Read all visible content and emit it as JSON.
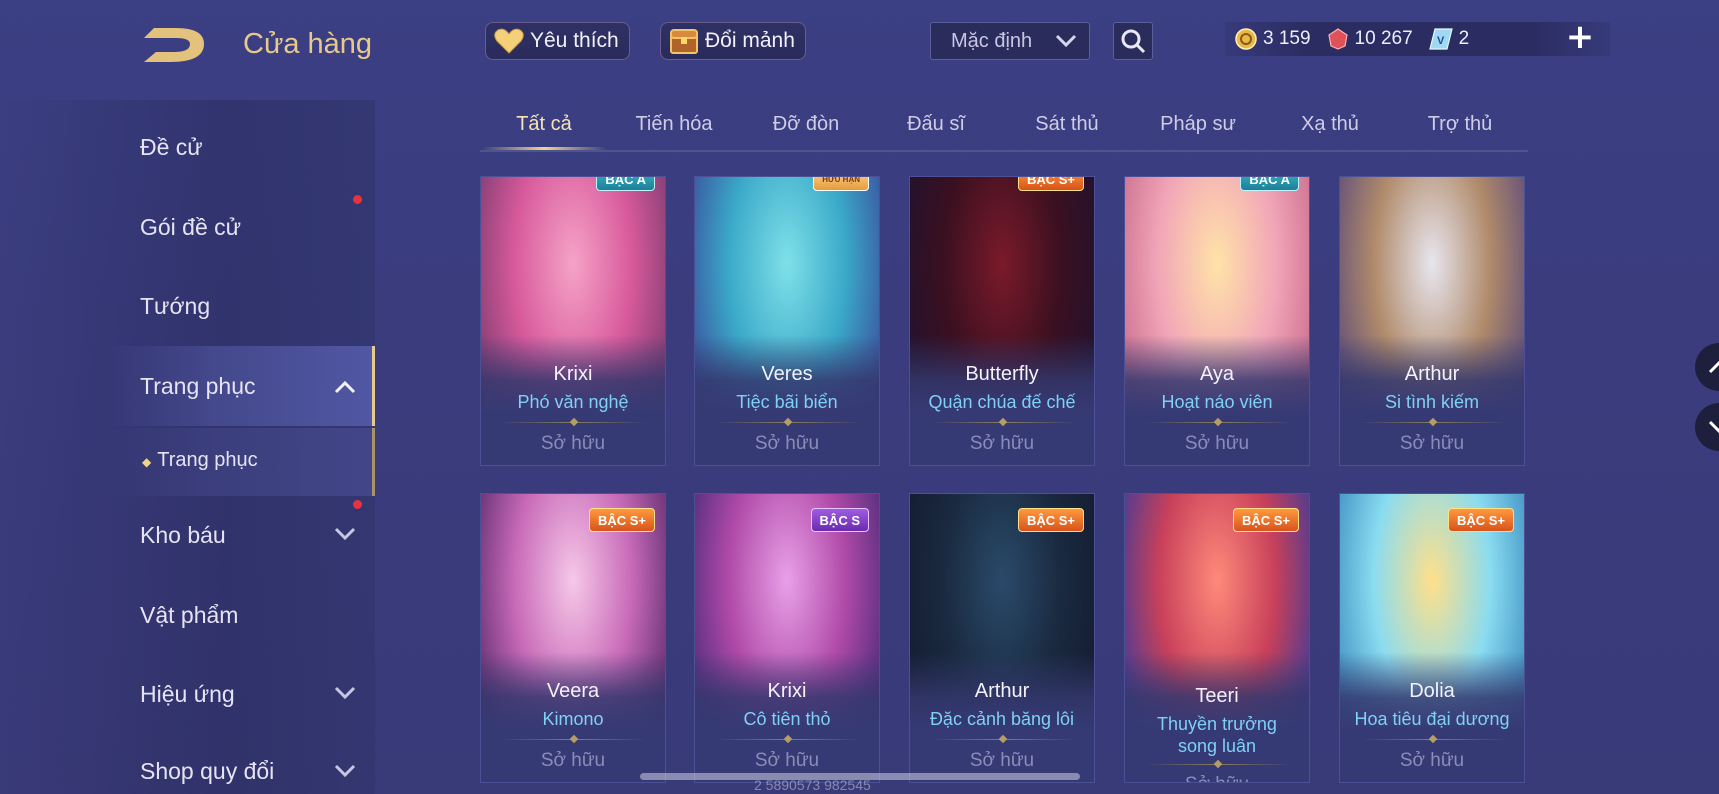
{
  "header": {
    "title": "Cửa hàng",
    "favorites_label": "Yêu thích",
    "exchange_label": "Đổi mảnh",
    "sort_value": "Mặc định",
    "currencies": [
      {
        "name": "gold-coin-icon",
        "value": "3 159"
      },
      {
        "name": "ruby-icon",
        "value": "10 267"
      },
      {
        "name": "voucher-icon",
        "value": "2"
      }
    ],
    "plus_label": "+"
  },
  "sidebar": {
    "items": [
      {
        "label": "Đề cử",
        "dot": false
      },
      {
        "label": "Gói đề cử",
        "dot": true
      },
      {
        "label": "Tướng",
        "dot": false
      },
      {
        "label": "Trang phục",
        "dot": false,
        "expanded": true
      },
      {
        "label": "Trang phục",
        "sub": true
      },
      {
        "label": "Kho báu",
        "dot": true
      },
      {
        "label": "Vật phẩm",
        "dot": false
      },
      {
        "label": "Hiệu ứng",
        "dot": false
      },
      {
        "label": "Shop quy đổi",
        "dot": false
      }
    ]
  },
  "tabs": [
    "Tất cả",
    "Tiến hóa",
    "Đỡ đòn",
    "Đấu sĩ",
    "Sát thủ",
    "Pháp sư",
    "Xạ thủ",
    "Trợ thủ"
  ],
  "active_tab": "Tất cả",
  "cards": [
    {
      "hero": "Krixi",
      "skin": "Phó văn nghệ",
      "status": "Sở hữu",
      "badge": "BẬC A",
      "badge_type": "a",
      "colors": [
        "#f5a3c7",
        "#d85a9c",
        "#7a3a6e"
      ]
    },
    {
      "hero": "Veres",
      "skin": "Tiệc bãi biển",
      "status": "Sở hữu",
      "badge": "HỮU HẠN",
      "badge_type": "ltd",
      "colors": [
        "#7fe0e8",
        "#3aa9c9",
        "#3b4b9a"
      ]
    },
    {
      "hero": "Butterfly",
      "skin": "Quận chúa đế chế",
      "status": "Sở hữu",
      "badge": "BẬC S+",
      "badge_type": "spl",
      "colors": [
        "#7a1a2a",
        "#3b1020",
        "#1f1230"
      ]
    },
    {
      "hero": "Aya",
      "skin": "Hoạt náo viên",
      "status": "Sở hữu",
      "badge": "BẬC A",
      "badge_type": "a",
      "colors": [
        "#ffe3a8",
        "#f2a6b8",
        "#c86a8c"
      ]
    },
    {
      "hero": "Arthur",
      "skin": "Si tình kiếm",
      "status": "Sở hữu",
      "badge": "",
      "badge_type": "",
      "colors": [
        "#e8e6ef",
        "#b08a6a",
        "#5a4a7a"
      ]
    },
    {
      "hero": "Veera",
      "skin": "Kimono",
      "status": "Sở hữu",
      "badge": "BẬC S+",
      "badge_type": "spl",
      "colors": [
        "#f6c8e8",
        "#c86ab8",
        "#5a2a6a"
      ]
    },
    {
      "hero": "Krixi",
      "skin": "Cô tiên thỏ",
      "status": "Sở hữu",
      "badge": "BẬC S",
      "badge_type": "s",
      "colors": [
        "#e8a0e8",
        "#b04aa8",
        "#4a2a78"
      ]
    },
    {
      "hero": "Arthur",
      "skin": "Đặc cảnh băng lôi",
      "status": "Sở hữu",
      "badge": "BẬC S+",
      "badge_type": "spl",
      "colors": [
        "#2a4a6a",
        "#1a2a40",
        "#141a30"
      ]
    },
    {
      "hero": "Teeri",
      "skin": "Thuyền trưởng song luân",
      "status": "Sở hữu",
      "badge": "BẬC S+",
      "badge_type": "spl",
      "colors": [
        "#ff8a7a",
        "#c8405a",
        "#3a3a9a"
      ]
    },
    {
      "hero": "Dolia",
      "skin": "Hoa tiêu đại dương",
      "status": "Sở hữu",
      "badge": "BẬC S+",
      "badge_type": "spl",
      "colors": [
        "#ffe08a",
        "#8adcf0",
        "#3a8ac0"
      ]
    }
  ],
  "watermark": "2  5890573  982545"
}
